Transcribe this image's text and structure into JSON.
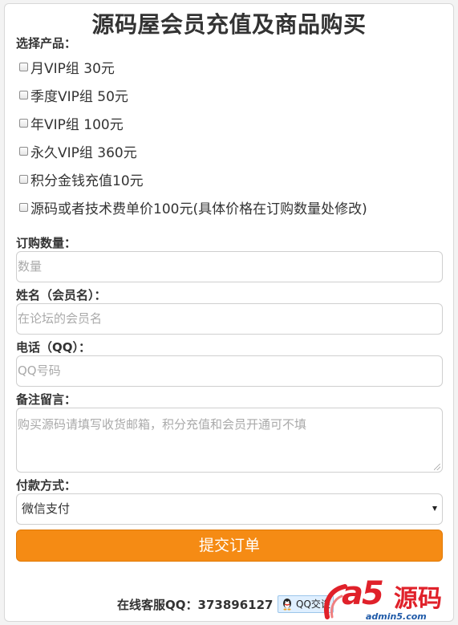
{
  "title": "源码屋会员充值及商品购买",
  "products": {
    "label": "选择产品：",
    "items": [
      "月VIP组 30元",
      "季度VIP组 50元",
      "年VIP组 100元",
      "永久VIP组 360元",
      "积分金钱充值10元",
      "源码或者技术费单价100元(具体价格在订购数量处修改)"
    ]
  },
  "quantity": {
    "label": "订购数量：",
    "placeholder": "数量"
  },
  "name": {
    "label": "姓名（会员名）：",
    "placeholder": "在论坛的会员名"
  },
  "phone": {
    "label": "电话（QQ）：",
    "placeholder": "QQ号码"
  },
  "remark": {
    "label": "备注留言：",
    "placeholder": "购买源码请填写收货邮箱，积分充值和会员开通可不填"
  },
  "payment": {
    "label": "付款方式：",
    "selected": "微信支付"
  },
  "submit_label": "提交订单",
  "support": {
    "text": "在线客服QQ：373896127",
    "qq_button": "QQ交谈"
  },
  "watermark": {
    "brand": "a5",
    "brand_cn": "源码",
    "url": "admin5.com"
  },
  "colors": {
    "accent": "#f58b14",
    "watermark_red": "#e0212a",
    "watermark_blue": "#1f5aa8"
  }
}
